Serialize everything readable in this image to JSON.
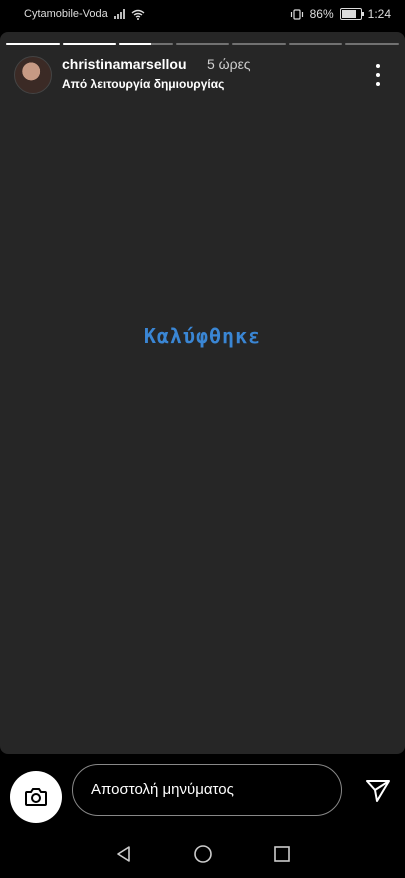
{
  "status_bar": {
    "carrier": "Cytamobile-Voda",
    "battery_percent": "86%",
    "battery_level": 0.86,
    "time": "1:24"
  },
  "story": {
    "progress_segments": [
      {
        "fill": 1.0
      },
      {
        "fill": 1.0
      },
      {
        "fill": 0.6
      },
      {
        "fill": 0
      },
      {
        "fill": 0
      },
      {
        "fill": 0
      },
      {
        "fill": 0
      }
    ],
    "username": "christinamarsellou",
    "time_ago": "5 ώρες",
    "subtitle": "Από λειτουργία δημιουργίας",
    "center_text": "Καλύφθηκε"
  },
  "footer": {
    "message_placeholder": "Αποστολή μηνύματος"
  },
  "icons": [
    "wifi-icon",
    "vibrate-icon",
    "battery-icon",
    "more-vert-icon",
    "camera-icon",
    "send-icon",
    "nav-back-icon",
    "nav-home-icon",
    "nav-recents-icon"
  ]
}
